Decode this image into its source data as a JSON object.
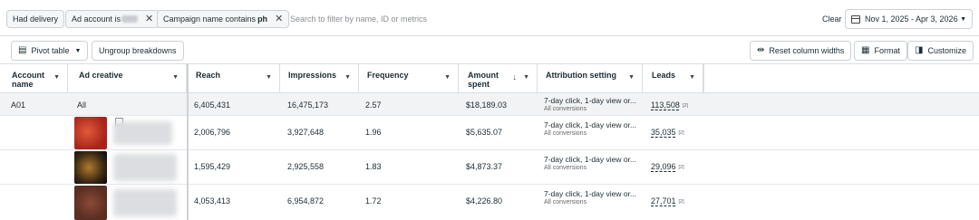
{
  "filters": {
    "chips": [
      {
        "label": "Had delivery"
      },
      {
        "label": "Ad account is"
      },
      {
        "label": "Campaign name contains",
        "value": "ph"
      }
    ],
    "search_placeholder": "Search to filter by name, ID or metrics",
    "clear_label": "Clear",
    "date_range": "Nov 1, 2025 - Apr 3, 2026"
  },
  "toolbar": {
    "pivot_label": "Pivot table",
    "ungroup_label": "Ungroup breakdowns",
    "reset_label": "Reset column widths",
    "format_label": "Format",
    "customize_label": "Customize"
  },
  "table": {
    "headers": {
      "account": "Account name",
      "creative": "Ad creative",
      "reach": "Reach",
      "impressions": "Impressions",
      "frequency": "Frequency",
      "amount": "Amount spent",
      "attribution": "Attribution setting",
      "leads": "Leads"
    },
    "total_row": {
      "account": "A01",
      "creative": "All",
      "reach": "6,405,431",
      "impressions": "16,475,173",
      "frequency": "2.57",
      "amount": "$18,189.03",
      "attribution": "7-day click, 1-day view or...",
      "attribution_sub": "All conversions",
      "leads": "113,508",
      "leads_note": "[2]"
    },
    "rows": [
      {
        "reach": "2,006,796",
        "impressions": "3,927,648",
        "frequency": "1.96",
        "amount": "$5,635.07",
        "attribution": "7-day click, 1-day view or...",
        "attribution_sub": "All conversions",
        "leads": "35,035",
        "leads_note": "[2]",
        "thumb_color": "#c0392b"
      },
      {
        "reach": "1,595,429",
        "impressions": "2,925,558",
        "frequency": "1.83",
        "amount": "$4,873.37",
        "attribution": "7-day click, 1-day view or...",
        "attribution_sub": "All conversions",
        "leads": "29,096",
        "leads_note": "[2]",
        "thumb_color": "#5a4a1e"
      },
      {
        "reach": "4,053,413",
        "impressions": "6,954,872",
        "frequency": "1.72",
        "amount": "$4,226.80",
        "attribution": "7-day click, 1-day view or...",
        "attribution_sub": "All conversions",
        "leads": "27,701",
        "leads_note": "[2]",
        "thumb_color": "#7a3a2a"
      }
    ]
  },
  "icons": {
    "close": "close-icon",
    "calendar": "calendar-icon",
    "pivot": "pivot-table-icon",
    "reset": "reset-column-widths-icon",
    "format": "format-icon",
    "customize": "customize-icon",
    "sort": "sort-caret-icon",
    "sort_down": "sort-down-arrow-icon",
    "dropdown": "chevron-down-icon"
  }
}
